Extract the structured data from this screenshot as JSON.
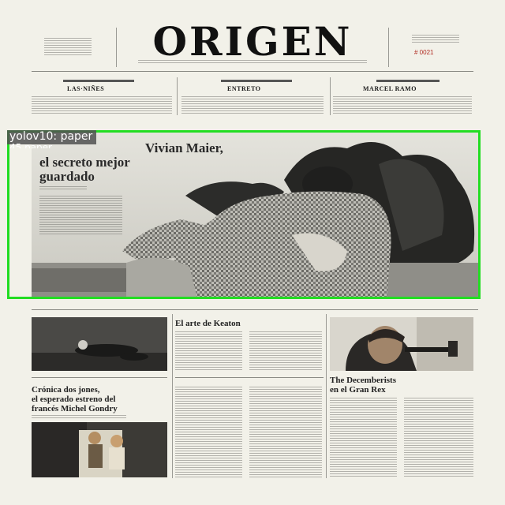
{
  "masthead": {
    "title": "ORIGEN",
    "date": "# 0021"
  },
  "teasers": [
    {
      "kicker": "",
      "head": "LAS·NIÑES"
    },
    {
      "kicker": "",
      "head": "ENTRETO"
    },
    {
      "kicker": "",
      "head": "MARCEL RAMO"
    }
  ],
  "hero": {
    "headline_1": "Vivian Maier,",
    "headline_2": "el secreto mejor",
    "headline_3": "guardado"
  },
  "articles": {
    "keaton": "El arte de Keaton",
    "godard_1": "Crónica dos jones,",
    "godard_2": "el esperado estreno del",
    "godard_3": "francés Michel Gondry",
    "decemberists_1": "The Decemberists",
    "decemberists_2": "en el Gran Rex"
  },
  "detection": {
    "label": "yolov10: paper",
    "label_overlap": "45 paper"
  },
  "colors": {
    "detection_box": "#22dd22",
    "date_red": "#b02a20",
    "paper": "#f2f1e9"
  }
}
